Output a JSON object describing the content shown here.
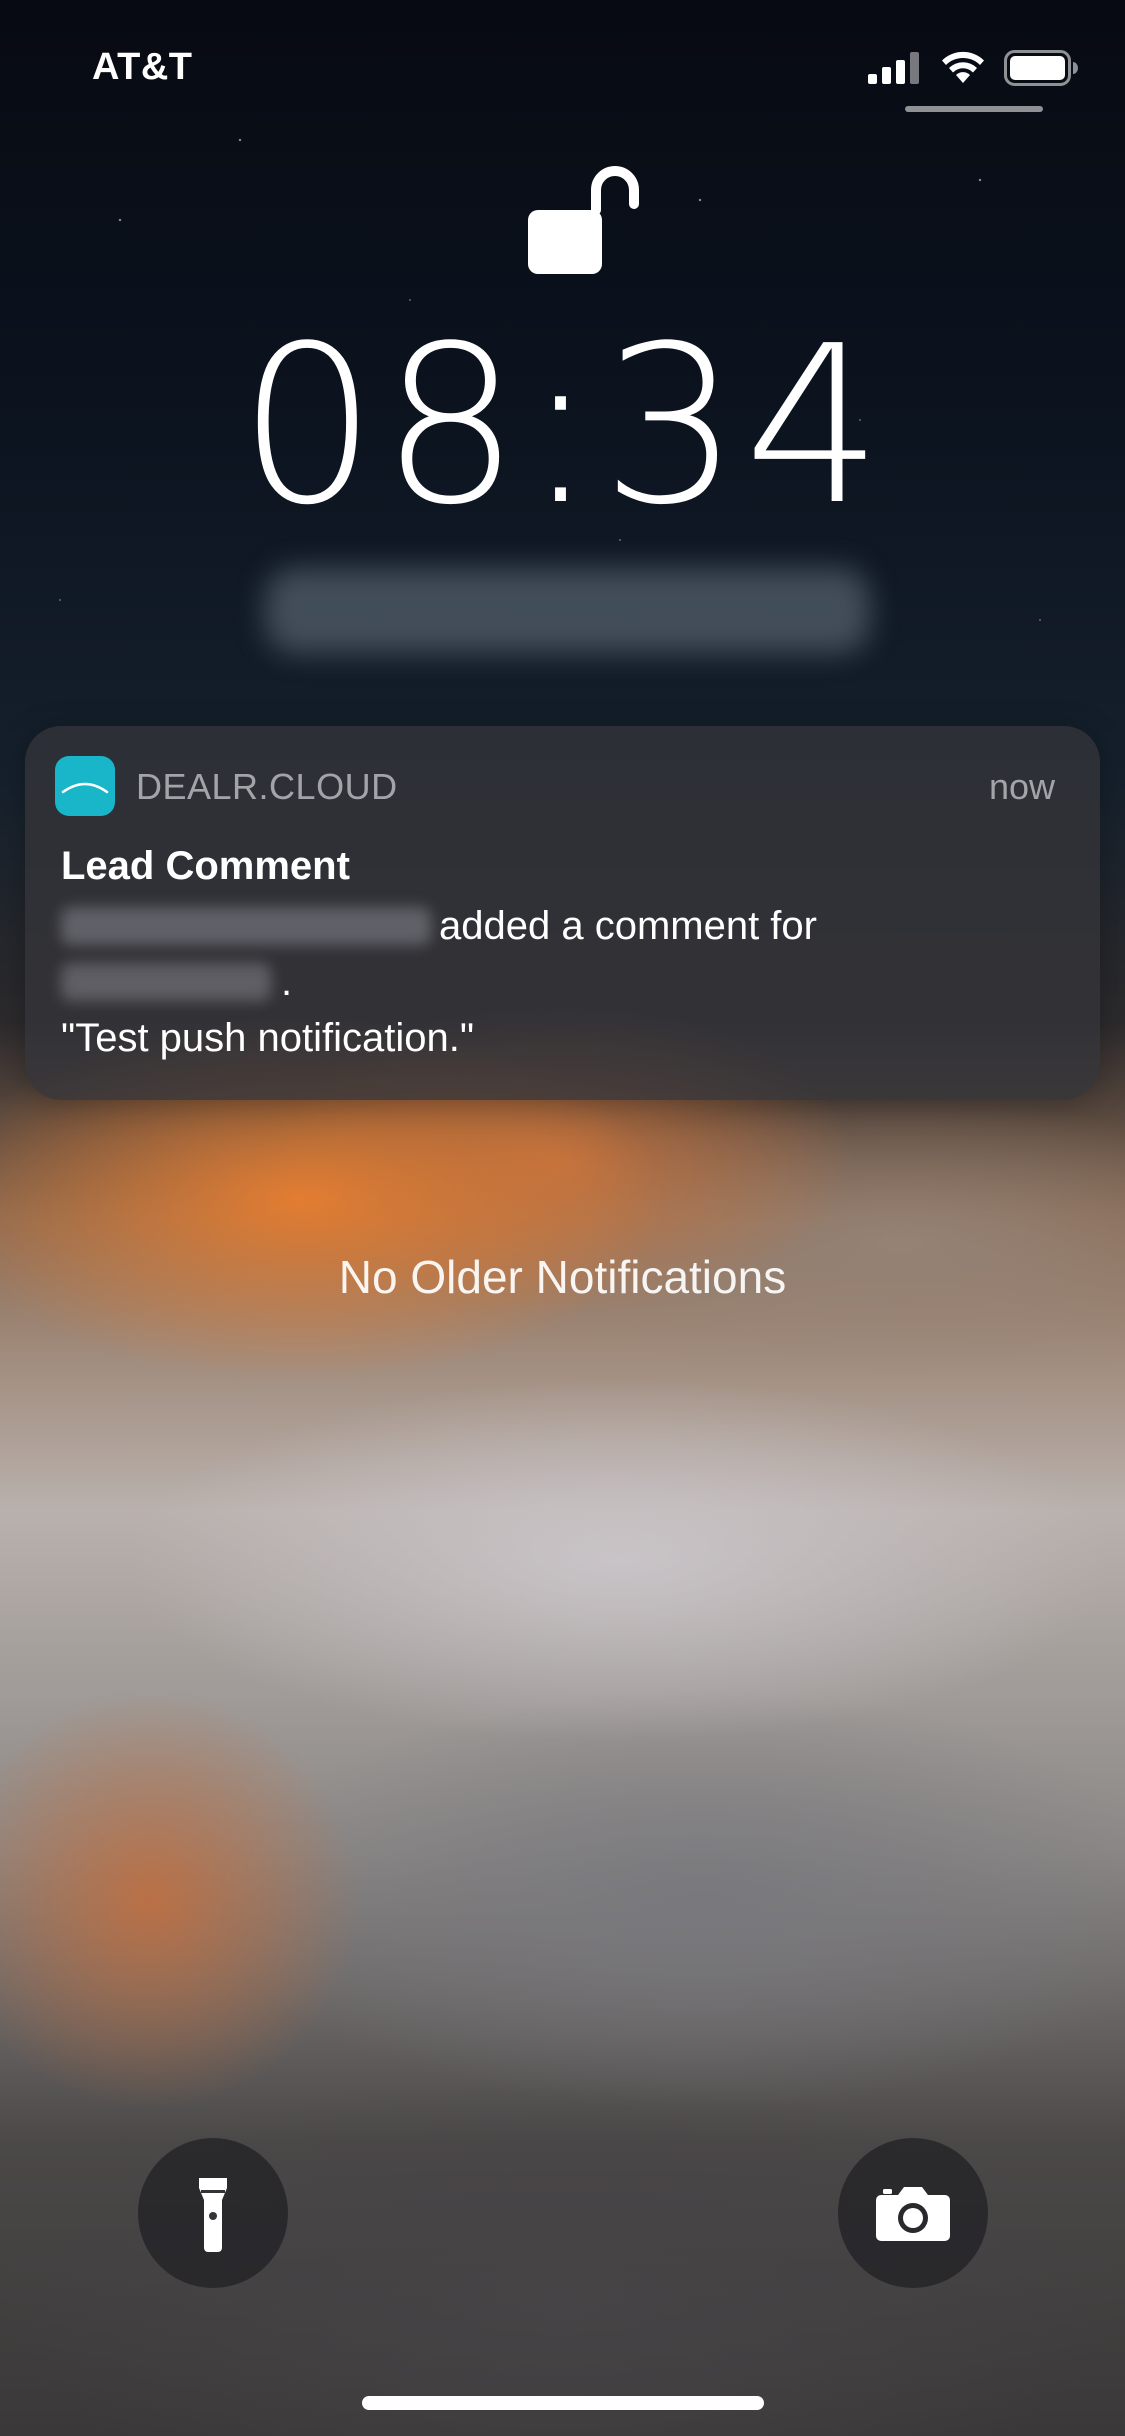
{
  "status_bar": {
    "carrier": "AT&T",
    "signal_icon": "cellular-signal-icon",
    "wifi_icon": "wifi-icon",
    "battery_icon": "battery-icon"
  },
  "lock_screen": {
    "lock_icon": "unlocked-padlock-icon",
    "time": "08:34"
  },
  "notification": {
    "app_name": "DEALR.CLOUD",
    "timestamp": "now",
    "title": "Lead Comment",
    "body_action": "added a comment for",
    "body_punct": ".",
    "body_quote": "\"Test push notification.\"",
    "app_icon_color": "#19b6c9"
  },
  "no_older_text": "No Older Notifications",
  "quick_actions": {
    "flashlight_icon": "flashlight-icon",
    "camera_icon": "camera-icon"
  }
}
